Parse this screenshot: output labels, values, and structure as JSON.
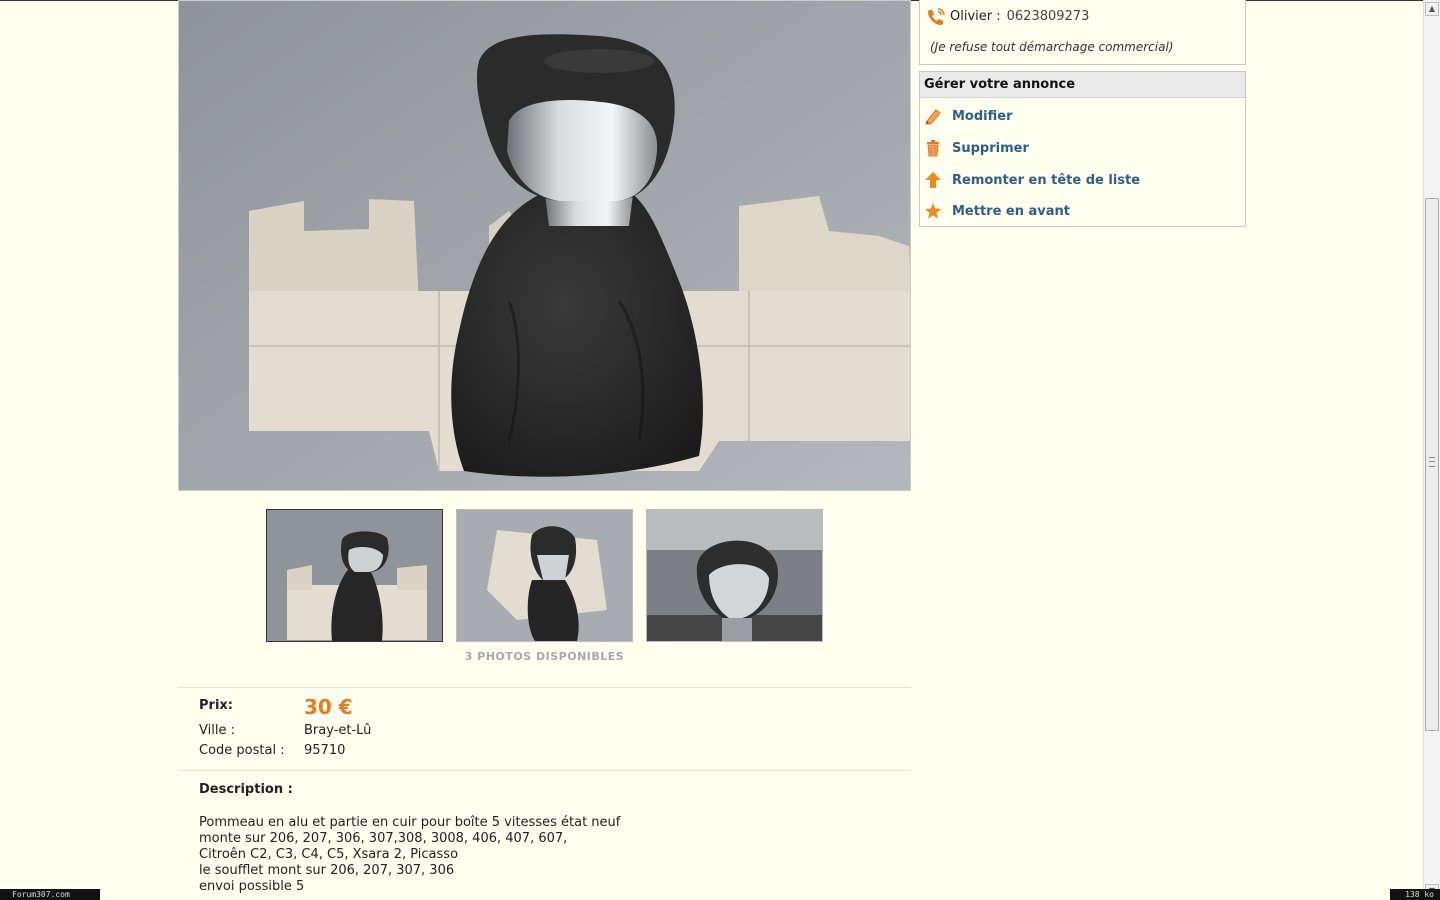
{
  "contact": {
    "name": "Olivier :",
    "phone": "0623809273",
    "note": "(Je refuse tout démarchage commercial)"
  },
  "manage": {
    "title": "Gérer votre annonce",
    "items": [
      {
        "label": "Modifier",
        "icon": "pencil-icon"
      },
      {
        "label": "Supprimer",
        "icon": "trash-icon"
      },
      {
        "label": "Remonter en tête de liste",
        "icon": "arrow-up-icon"
      },
      {
        "label": "Mettre en avant",
        "icon": "star-icon"
      }
    ]
  },
  "gallery": {
    "photos_count_label": "3 PHOTOS DISPONIBLES"
  },
  "details": {
    "price_label": "Prix:",
    "price_value": "30 €",
    "city_label": "Ville :",
    "city_value": "Bray-et-Lû",
    "postal_label": "Code postal :",
    "postal_value": "95710"
  },
  "description": {
    "title": "Description :",
    "lines": [
      "Pommeau en alu et partie en cuir pour boîte 5 vitesses état neuf",
      "monte sur 206, 207, 306, 307,308, 3008, 406, 407, 607,",
      "Citroên C2, C3, C4, C5, Xsara 2, Picasso",
      "le soufflet mont sur 206, 207, 307, 306",
      "envoi possible 5"
    ]
  },
  "status": {
    "left": "Forum307.com",
    "right": "138 ko"
  },
  "colors": {
    "page_bg": "#fffff0",
    "link": "#2e5d8e",
    "price": "#e87b1e",
    "icon_orange": "#e8781e"
  }
}
